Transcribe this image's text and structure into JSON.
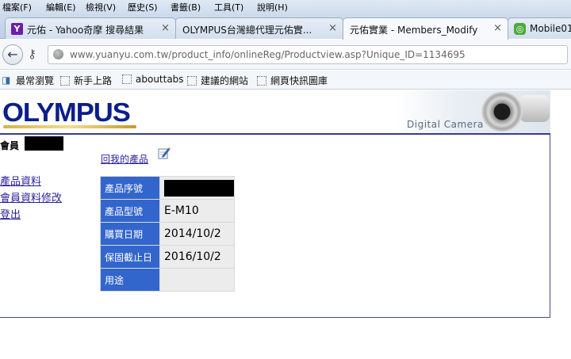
{
  "menubar": {
    "items": [
      "檔案(F)",
      "編輯(E)",
      "檢視(V)",
      "歷史(S)",
      "書籤(B)",
      "工具(T)",
      "說明(H)"
    ]
  },
  "tabs": [
    {
      "label": "元佑 - Yahoo奇摩 搜尋結果",
      "icon": "yahoo-icon",
      "active": false
    },
    {
      "label": "OLYMPUS台灣總代理元佑實...",
      "icon": "none",
      "active": false
    },
    {
      "label": "元佑實業 - Members_Modify",
      "icon": "none",
      "active": true
    },
    {
      "label": "Mobile01",
      "icon": "mobile01-icon",
      "active": false
    }
  ],
  "tab_close_glyph": "×",
  "navbar": {
    "url": "www.yuanyu.com.tw/product_info/onlineReg/Productview.asp?Unique_ID=1134695"
  },
  "bookmarks": [
    "最常瀏覽",
    "新手上路",
    "abouttabs",
    "建議的網站",
    "網頁快訊圖庫"
  ],
  "header": {
    "logo": "OLYMPUS",
    "camera_text": "Digital Camera"
  },
  "member": {
    "label": "會員"
  },
  "sidebar": {
    "links": [
      "產品資料",
      "會員資料修改",
      "登出"
    ]
  },
  "main": {
    "back_link": "回我的產品",
    "product_rows": [
      {
        "label": "產品序號",
        "value": ""
      },
      {
        "label": "產品型號",
        "value": "E-M10"
      },
      {
        "label": "購買日期",
        "value": "2014/10/2"
      },
      {
        "label": "保固截止日",
        "value": "2016/10/2"
      },
      {
        "label": "用途",
        "value": ""
      }
    ]
  },
  "colors": {
    "table_label_bg": "#3366cc",
    "table_value_bg": "#ececec",
    "link": "#2a1f9b",
    "logo": "#0b1e8a"
  }
}
